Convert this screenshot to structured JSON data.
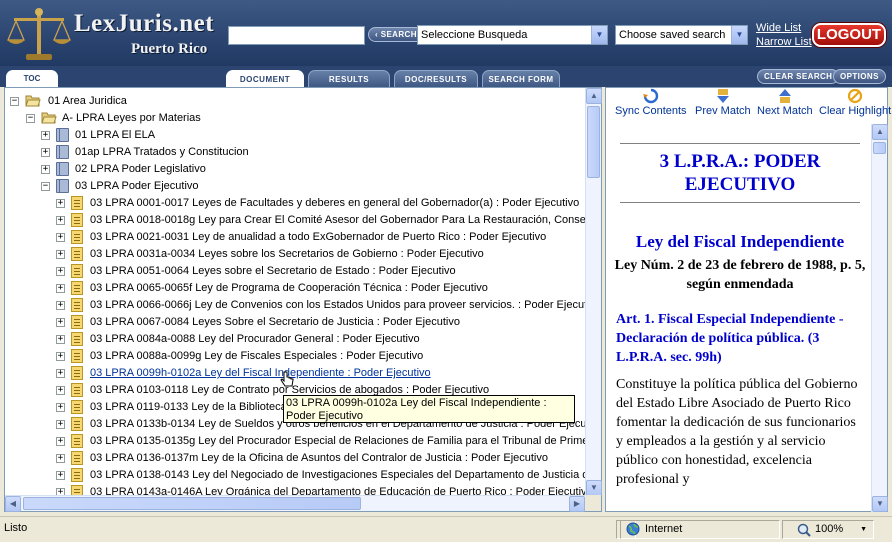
{
  "header": {
    "brand": "LexJuris.net",
    "brand_sub": "Puerto Rico",
    "search_value": "",
    "search_button": "SEARCH",
    "select_search": "Seleccione Busqueda",
    "select_saved": "Choose saved search",
    "wide_list": "Wide List",
    "narrow_list": "Narrow List",
    "logout": "LOGOUT"
  },
  "tabs": {
    "toc": "TOC",
    "items": [
      "DOCUMENT",
      "RESULTS",
      "DOC/RESULTS",
      "SEARCH FORM"
    ],
    "clear_search": "CLEAR SEARCH",
    "options": "OPTIONS"
  },
  "tree": {
    "root": "01 Area Juridica",
    "category": "A- LPRA Leyes por Materias",
    "books": [
      "01 LPRA El ELA",
      "01ap LPRA Tratados y Constitucion",
      "02 LPRA Poder Legislativo",
      "03 LPRA Poder Ejecutivo"
    ],
    "docs": [
      "03 LPRA 0001-0017 Leyes de Facultades y deberes en general del Gobernador(a) : Poder Ejecutivo",
      "03 LPRA 0018-0018g Ley para Crear El Comité Asesor del Gobernador Para La Restauración, Conserva",
      "03 LPRA 0021-0031 Ley de anualidad a todo ExGobernador de Puerto Rico : Poder Ejecutivo",
      "03 LPRA 0031a-0034 Leyes sobre los Secretarios de Gobierno : Poder Ejecutivo",
      "03 LPRA 0051-0064 Leyes sobre el Secretario de Estado : Poder Ejecutivo",
      "03 LPRA 0065-0065f Ley de Programa de Cooperación Técnica : Poder Ejecutivo",
      "03 LPRA 0066-0066j Ley de Convenios con los Estados Unidos para proveer servicios. : Poder Ejecutivo",
      "03 LPRA 0067-0084 Leyes Sobre el Secretario de Justicia : Poder Ejecutivo",
      "03 LPRA 0084a-0088 Ley del Procurador General : Poder Ejecutivo",
      "03 LPRA 0088a-0099g Ley de Fiscales Especiales : Poder Ejecutivo",
      "03 LPRA 0099h-0102a Ley del Fiscal Independiente : Poder Ejecutivo",
      "03 LPRA 0103-0118 Ley de Contrato por Servicios de abogados : Poder Ejecutivo",
      "03 LPRA 0119-0133 Ley de la Biblioteca",
      "03 LPRA 0133b-0134 Ley de Sueldos y otros beneficios en el Departamento de Justicia : Poder Ejecutivo",
      "03 LPRA 0135-0135g Ley del Procurador Especial de Relaciones de Familia para el Tribunal de Primera I",
      "03 LPRA 0136-0137m Ley de la Oficina de Asuntos del Contralor de Justicia : Poder Ejecutivo",
      "03 LPRA 0138-0143 Ley del Negociado de Investigaciones Especiales del Departamento de Justicia del I",
      "03 LPRA 0143a-0146A Ley Orgánica del Departamento de Educación de Puerto Rico : Poder Ejecutivo"
    ],
    "tooltip": "03 LPRA 0099h-0102a Ley del Fiscal Independiente : Poder Ejecutivo"
  },
  "toolbar": {
    "sync": "Sync Contents",
    "prev": "Prev Match",
    "next": "Next Match",
    "clear": "Clear Highlight"
  },
  "document": {
    "title": "3 L.P.R.A.: PODER EJECUTIVO",
    "law_title": "Ley del Fiscal Independiente",
    "law_sub": "Ley Núm. 2 de 23 de febrero de 1988, p. 5, según enmendada",
    "article": "Art. 1. Fiscal Especial Independiente - Declaración de política pública. (3 L.P.R.A. sec. 99h)",
    "body": "Constituye la política pública del Gobierno del Estado Libre Asociado de Puerto Rico fomentar la dedicación de sus funcionarios y empleados a la gestión y al servicio público con honestidad, excelencia profesional y"
  },
  "status": {
    "text": "Listo",
    "zone": "Internet",
    "zoom": "100%"
  }
}
